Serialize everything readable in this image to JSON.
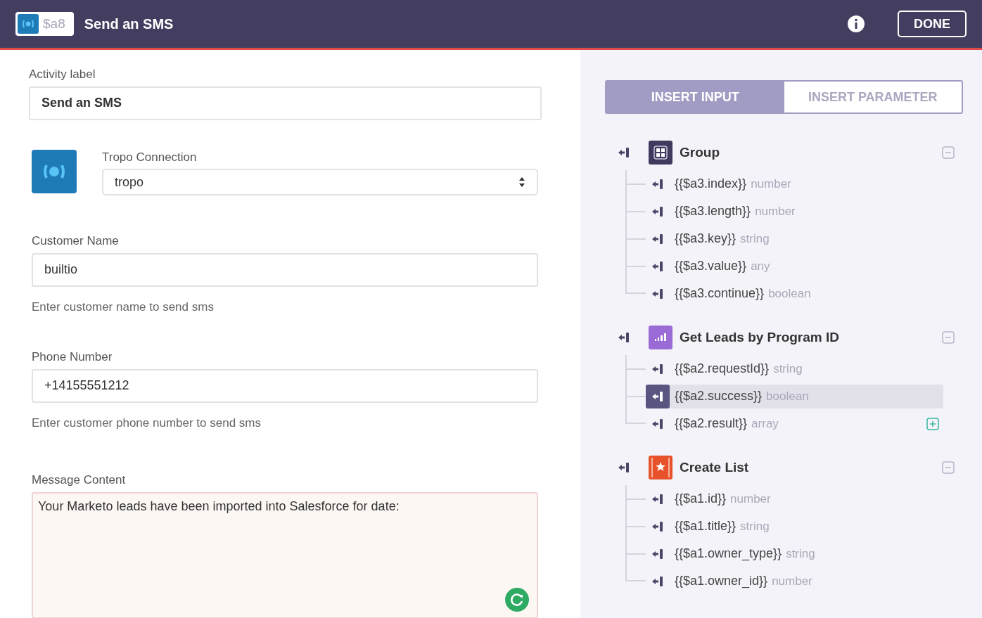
{
  "header": {
    "badge": "$a8",
    "title": "Send an SMS",
    "done": "DONE"
  },
  "form": {
    "activity_label": {
      "label": "Activity label",
      "value": "Send an SMS"
    },
    "connection": {
      "label": "Tropo Connection",
      "value": "tropo"
    },
    "fields": [
      {
        "label": "Customer Name",
        "value": "builtio",
        "hint": "Enter customer name to send sms"
      },
      {
        "label": "Phone Number",
        "value": "+14155551212",
        "hint": "Enter customer phone number to send sms"
      }
    ],
    "message": {
      "label": "Message Content",
      "value": "Your Marketo leads have been imported into Salesforce for date:"
    }
  },
  "tabs": [
    {
      "label": "INSERT INPUT",
      "selected": true
    },
    {
      "label": "INSERT PARAMETER",
      "selected": false
    }
  ],
  "groups": [
    {
      "kind": "grid",
      "title": "Group",
      "expanded": true,
      "children": [
        {
          "name": "{{$a3.index}}",
          "type": "number",
          "selected": false,
          "expandable": false
        },
        {
          "name": "{{$a3.length}}",
          "type": "number",
          "selected": false,
          "expandable": false
        },
        {
          "name": "{{$a3.key}}",
          "type": "string",
          "selected": false,
          "expandable": false
        },
        {
          "name": "{{$a3.value}}",
          "type": "any",
          "selected": false,
          "expandable": false
        },
        {
          "name": "{{$a3.continue}}",
          "type": "boolean",
          "selected": false,
          "expandable": false
        }
      ]
    },
    {
      "kind": "chart",
      "title": "Get Leads by Program ID",
      "expanded": true,
      "children": [
        {
          "name": "{{$a2.requestId}}",
          "type": "string",
          "selected": false,
          "expandable": false
        },
        {
          "name": "{{$a2.success}}",
          "type": "boolean",
          "selected": true,
          "expandable": false
        },
        {
          "name": "{{$a2.result}}",
          "type": "array",
          "selected": false,
          "expandable": true
        }
      ]
    },
    {
      "kind": "star",
      "title": "Create List",
      "expanded": true,
      "children": [
        {
          "name": "{{$a1.id}}",
          "type": "number",
          "selected": false,
          "expandable": false
        },
        {
          "name": "{{$a1.title}}",
          "type": "string",
          "selected": false,
          "expandable": false
        },
        {
          "name": "{{$a1.owner_type}}",
          "type": "string",
          "selected": false,
          "expandable": false
        },
        {
          "name": "{{$a1.owner_id}}",
          "type": "number",
          "selected": false,
          "expandable": false
        }
      ]
    }
  ]
}
